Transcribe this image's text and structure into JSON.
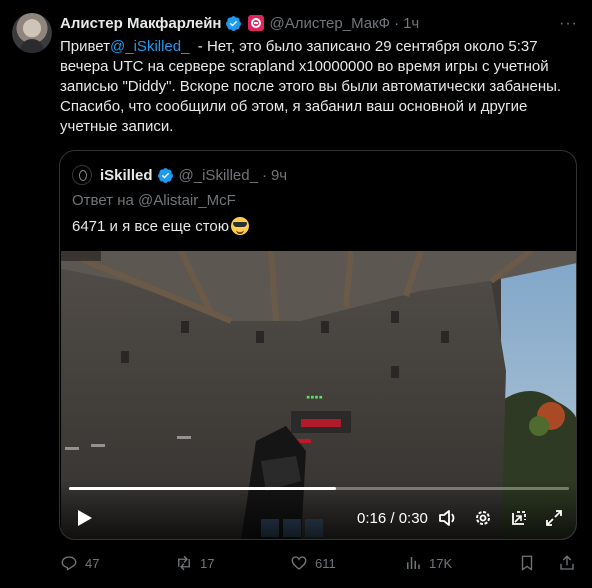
{
  "tweet": {
    "author_name": "Алистер Макфарлейн",
    "author_handle": "@Алистер_МакФ",
    "separator": "·",
    "time": "1ч",
    "text_prefix": "Привет",
    "mention": "@_iSkilled_",
    "text_body": "  - Нет, это было записано 29 сентября около 5:37 вечера UTC на сервере scrapland x10000000 во время игры с учетной записью \"Diddy\". Вскоре после этого вы были автоматически забанены. Спасибо, что сообщили об этом, я забанил ваш основной и другие учетные записи.",
    "more_icon": "more-icon"
  },
  "quote": {
    "author_name": "iSkilled",
    "author_handle": "@_iSkilled_",
    "separator": "·",
    "time": "9ч",
    "reply_to": "Ответ на @Alistair_McF",
    "text": "6471 и я все еще стою",
    "emoji": "smiling-face-with-sunglasses"
  },
  "video": {
    "time_display": "0:16 / 0:30",
    "progress": 0.533
  },
  "actions": {
    "reply_count": "47",
    "retweet_count": "17",
    "like_count": "611",
    "views_count": "17K"
  },
  "colors": {
    "accent": "#1d9bf0",
    "text": "#e7e9ea",
    "muted": "#71767b",
    "background": "#000000",
    "border": "#2f3336"
  }
}
